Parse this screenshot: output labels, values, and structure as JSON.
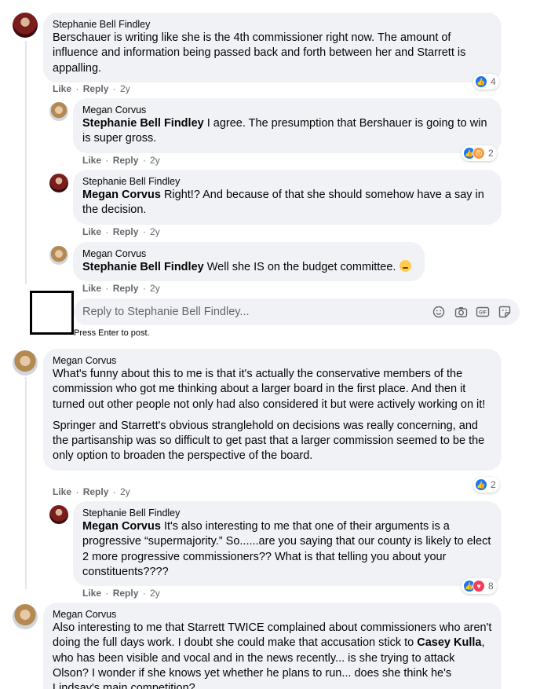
{
  "comments": [
    {
      "author": "Stephanie Bell Findley",
      "text": "Berschauer is writing like she is the 4th commissioner right now. The amount of influence and information being passed back and forth between her and Starrett is appalling.",
      "like": "Like",
      "reply": "Reply",
      "time": "2y",
      "reaction_count": "4"
    },
    {
      "author": "Megan Corvus",
      "mention": "Stephanie Bell Findley",
      "text": " I agree. The presumption that Bershauer is going to win is super gross.",
      "like": "Like",
      "reply": "Reply",
      "time": "2y",
      "reaction_count": "2"
    },
    {
      "author": "Stephanie Bell Findley",
      "mention": "Megan Corvus",
      "text": " Right!? And because of that she should somehow have a say in the decision.",
      "like": "Like",
      "reply": "Reply",
      "time": "2y"
    },
    {
      "author": "Megan Corvus",
      "mention": "Stephanie Bell Findley",
      "text": " Well she IS on the budget committee.",
      "like": "Like",
      "reply": "Reply",
      "time": "2y"
    },
    {
      "author": "Megan Corvus",
      "para1": "What's funny about this to me is that it's actually the conservative members of the commission who got me thinking about a larger board in the first place. And then it turned out other people not only had also considered it but were actively working on it!",
      "para2": "Springer and Starrett's obvious stranglehold on decisions was really concerning, and the partisanship was so difficult to get past that a larger commission seemed to be the only option to broaden the perspective of the board.",
      "like": "Like",
      "reply": "Reply",
      "time": "2y",
      "reaction_count": "2"
    },
    {
      "author": "Stephanie Bell Findley",
      "mention": "Megan Corvus",
      "text": " It's also interesting to me that one of their arguments is a progressive “supermajority.” So......are you saying that our county is likely to elect 2 more progressive commissioners?? What is that telling you about your constituents????",
      "like": "Like",
      "reply": "Reply",
      "time": "2y",
      "reaction_count": "8"
    },
    {
      "author": "Megan Corvus",
      "text_a": "Also interesting to me that Starrett TWICE complained about commissioners who aren't doing the full days work. I doubt she could make that accusation stick to ",
      "mention": "Casey Kulla",
      "text_b": ", who has been visible and vocal and in the news recently... is she trying to attack Olson? I wonder if she knows yet whether he plans to run... does she think he's Lindsay's main competition?"
    }
  ],
  "reply_box": {
    "placeholder": "Reply to Stephanie Bell Findley...",
    "hint": "Press Enter to post."
  },
  "icons": {
    "like": "thumbs-up-icon",
    "angry": "angry-face-icon",
    "love": "heart-icon",
    "emoji": "smiley-icon",
    "camera": "camera-icon",
    "gif": "gif-icon",
    "sticker": "sticker-icon"
  },
  "colors": {
    "bubble": "#f0f2f5",
    "meta_text": "#65676b",
    "like_blue": "#1877f2",
    "love_red": "#f33e58",
    "angry_orange": "#f5993d"
  }
}
